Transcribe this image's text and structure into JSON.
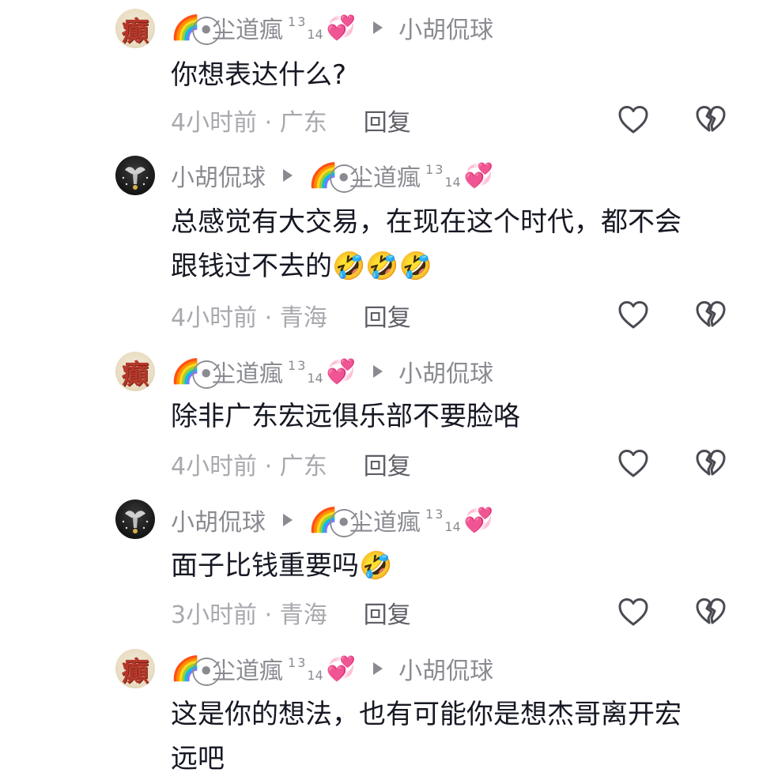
{
  "comments": [
    {
      "author_variant": "a",
      "avatar_glyph": "癲",
      "header_left": {
        "emoji": "🌈",
        "name": "ꔷ⃝尘道瘋",
        "sup": "1",
        "sup2": "3",
        "sub": "14",
        "badge": "💞"
      },
      "header_right": "小胡侃球",
      "text_lines": [
        "你想表达什么?"
      ],
      "meta": "4小时前 · 广东",
      "reply": "回复"
    },
    {
      "author_variant": "b",
      "header_left_name": "小胡侃球",
      "header_right": {
        "emoji": "🌈",
        "name": "ꔷ⃝尘道瘋",
        "sup": "1",
        "sup2": "3",
        "sub": "14",
        "badge": "💞"
      },
      "text_lines": [
        "总感觉有大交易，在现在这个时代，都不会",
        "跟钱过不去的🤣🤣🤣"
      ],
      "meta": "4小时前 · 青海",
      "reply": "回复"
    },
    {
      "author_variant": "a",
      "avatar_glyph": "癲",
      "header_left": {
        "emoji": "🌈",
        "name": "ꔷ⃝尘道瘋",
        "sup": "1",
        "sup2": "3",
        "sub": "14",
        "badge": "💞"
      },
      "header_right": "小胡侃球",
      "text_lines": [
        "除非广东宏远俱乐部不要脸咯"
      ],
      "meta": "4小时前 · 广东",
      "reply": "回复"
    },
    {
      "author_variant": "b",
      "header_left_name": "小胡侃球",
      "header_right": {
        "emoji": "🌈",
        "name": "ꔷ⃝尘道瘋",
        "sup": "1",
        "sup2": "3",
        "sub": "14",
        "badge": "💞"
      },
      "text_lines": [
        "面子比钱重要吗🤣"
      ],
      "meta": "3小时前 · 青海",
      "reply": "回复"
    },
    {
      "author_variant": "a",
      "avatar_glyph": "癲",
      "header_left": {
        "emoji": "🌈",
        "name": "ꔷ⃝尘道瘋",
        "sup": "1",
        "sup2": "3",
        "sub": "14",
        "badge": "💞"
      },
      "header_right": "小胡侃球",
      "text_lines": [
        "这是你的想法，也有可能你是想杰哥离开宏",
        "远吧"
      ],
      "meta": "",
      "reply": ""
    }
  ],
  "colors": {
    "name": "#8a8b91",
    "meta": "#a8a9ae",
    "text": "#161823",
    "icon": "#4a4b52"
  },
  "icons": {
    "like": "heart-outline-icon",
    "dislike": "broken-heart-outline-icon",
    "arrow": "triangle-right-icon"
  }
}
